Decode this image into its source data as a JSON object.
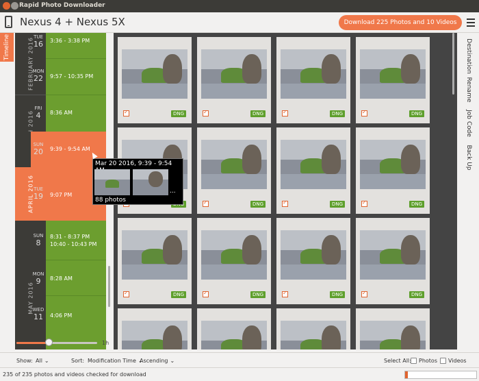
{
  "window": {
    "title": "Rapid Photo Downloader",
    "colors": {
      "close": "#e0642f",
      "minimize": "#9a9792",
      "maximize": "#9a9792"
    }
  },
  "toolbar": {
    "device_icon": "smartphone-icon",
    "device_name": "Nexus 4 + Nexus 5X",
    "download_label": "Download 225 Photos and 10 Videos",
    "menu_icon": "hamburger-menu-icon",
    "accent": "#f0784a"
  },
  "left_tab": {
    "label": "Timeline"
  },
  "timeline": {
    "colors": {
      "green": "#6c9e2f",
      "orange": "#f0784a",
      "dark": "#3c3b37"
    },
    "months": [
      {
        "label": "FEBRUARY 2016"
      },
      {
        "label": "MARCH 2016"
      },
      {
        "label": "APRIL 2016"
      },
      {
        "label": "MAY 2016"
      }
    ],
    "entries": [
      {
        "dow": "TUE",
        "day": "16",
        "range": "3:36 - 3:38 PM"
      },
      {
        "dow": "MON",
        "day": "22",
        "range": "9:57 - 10:35 PM"
      },
      {
        "dow": "FRI",
        "day": "4",
        "range": "8:36 AM"
      },
      {
        "dow": "SUN",
        "day": "20",
        "range": "9:39 - 9:54 AM"
      },
      {
        "dow": "TUE",
        "day": "19",
        "range": "9:07 PM"
      },
      {
        "dow": "SUN",
        "day": "8",
        "range": "8:31 - 8:37 PM",
        "range2": "10:40 - 10:43 PM"
      },
      {
        "dow": "MON",
        "day": "9",
        "range": "8:28 AM"
      },
      {
        "dow": "WED",
        "day": "11",
        "range": "4:06 PM"
      }
    ]
  },
  "zoom_slider": {
    "value": 0.4,
    "label": "1h"
  },
  "tooltip": {
    "title": "Mar 20 2016, 9:39 - 9:54 AM",
    "more": "...",
    "count": "88 photos"
  },
  "thumbnails": {
    "badge_color": "#5e9f2c",
    "items": [
      {
        "badge": "DNG",
        "checked": true
      },
      {
        "badge": "DNG",
        "checked": true
      },
      {
        "badge": "DNG",
        "checked": true
      },
      {
        "badge": "DNG",
        "checked": true
      },
      {
        "badge": "DNG",
        "checked": true
      },
      {
        "badge": "DNG",
        "checked": true
      },
      {
        "badge": "DNG",
        "checked": true
      },
      {
        "badge": "DNG",
        "checked": true
      },
      {
        "badge": "DNG",
        "checked": true
      },
      {
        "badge": "DNG",
        "checked": true
      },
      {
        "badge": "DNG",
        "checked": true
      },
      {
        "badge": "DNG",
        "checked": true
      },
      {
        "badge": "",
        "checked": false
      },
      {
        "badge": "",
        "checked": false
      },
      {
        "badge": "",
        "checked": false
      },
      {
        "badge": "",
        "checked": false
      }
    ]
  },
  "right_tabs": [
    "Destination",
    "Rename",
    "Job Code",
    "Back Up"
  ],
  "bottom": {
    "show_label": "Show:",
    "show_value": "All",
    "sort_label": "Sort:",
    "sort_value": "Modification Time",
    "order_value": "Ascending",
    "select_all_label": "Select All:",
    "photos_label": "Photos",
    "videos_label": "Videos",
    "chevron_icon": "chevron-down-icon"
  },
  "status": {
    "text": "235 of 235 photos and videos checked for download",
    "progress": 0.04
  }
}
